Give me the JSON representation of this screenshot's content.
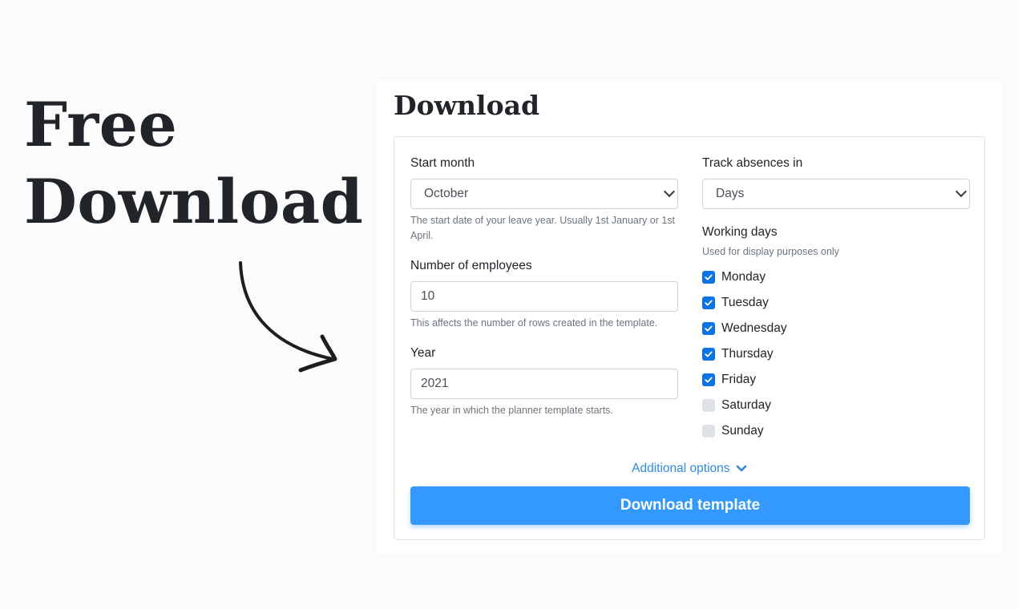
{
  "hero": {
    "line1": "Free",
    "line2": "Download"
  },
  "panel": {
    "title": "Download"
  },
  "form": {
    "start_month": {
      "label": "Start month",
      "value": "October",
      "help": "The start date of your leave year. Usually 1st January or 1st April."
    },
    "employees": {
      "label": "Number of employees",
      "value": "10",
      "help": "This affects the number of rows created in the template."
    },
    "year": {
      "label": "Year",
      "value": "2021",
      "help": "The year in which the planner template starts."
    },
    "track_absences": {
      "label": "Track absences in",
      "value": "Days"
    },
    "working_days": {
      "label": "Working days",
      "help": "Used for display purposes only",
      "days": [
        {
          "label": "Monday",
          "checked": true
        },
        {
          "label": "Tuesday",
          "checked": true
        },
        {
          "label": "Wednesday",
          "checked": true
        },
        {
          "label": "Thursday",
          "checked": true
        },
        {
          "label": "Friday",
          "checked": true
        },
        {
          "label": "Saturday",
          "checked": false
        },
        {
          "label": "Sunday",
          "checked": false
        }
      ]
    },
    "additional_options_label": "Additional options",
    "download_button_label": "Download template"
  },
  "colors": {
    "accent": "#3399ff",
    "link": "#2e8ae6",
    "checkbox_on": "#0d72e6",
    "checkbox_off": "#dfe2e6"
  },
  "icons": {
    "arrow": "hand-drawn-arrow-icon",
    "chevron": "chevron-down-icon",
    "check": "check-icon"
  }
}
